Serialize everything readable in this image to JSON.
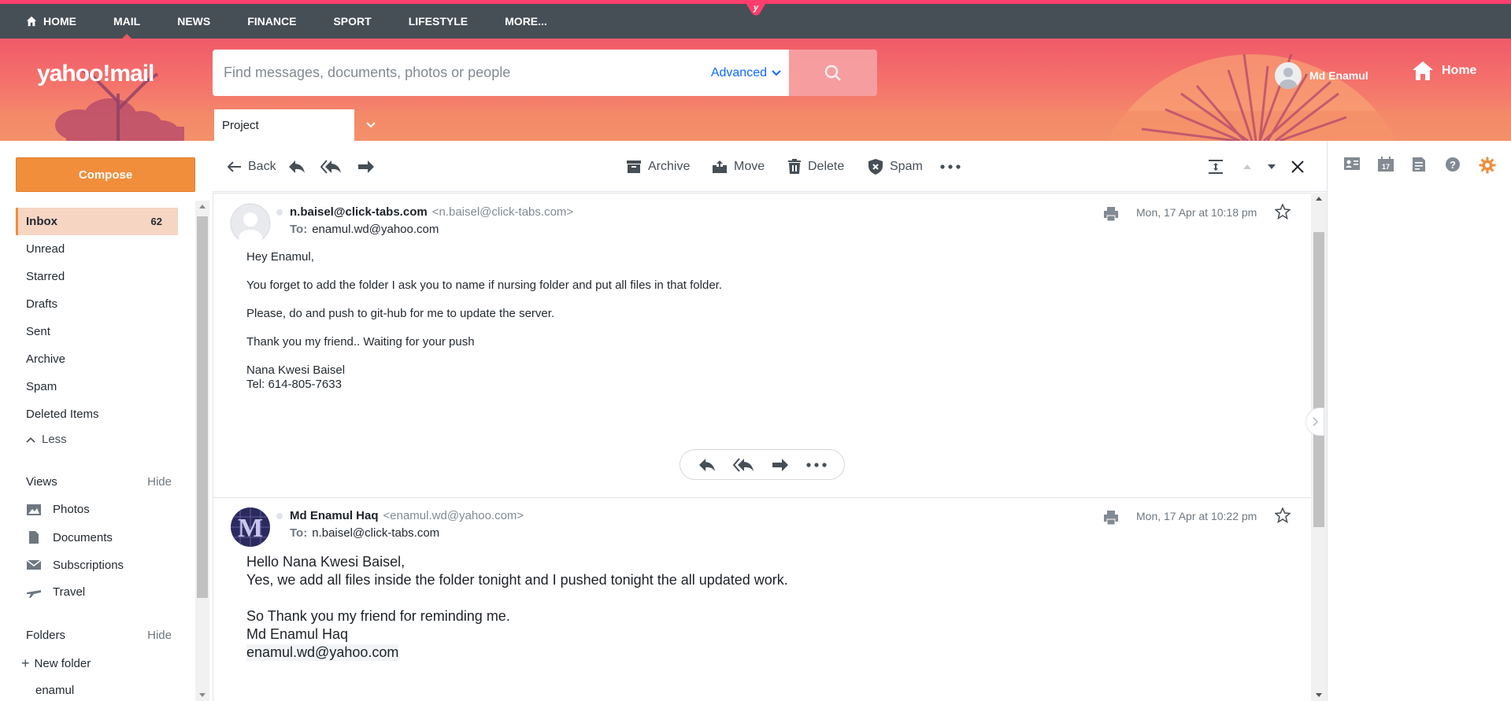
{
  "topnav": {
    "items": [
      {
        "label": "HOME"
      },
      {
        "label": "MAIL"
      },
      {
        "label": "NEWS"
      },
      {
        "label": "FINANCE"
      },
      {
        "label": "SPORT"
      },
      {
        "label": "LIFESTYLE"
      },
      {
        "label": "MORE..."
      }
    ],
    "active": "MAIL"
  },
  "header": {
    "logo": "yahoo!mail",
    "search_placeholder": "Find messages, documents, photos or people",
    "advanced_label": "Advanced",
    "user_name": "Md Enamul",
    "home_label": "Home",
    "tab_label": "Project"
  },
  "sidebar": {
    "compose_label": "Compose",
    "folders": [
      {
        "label": "Inbox",
        "count": "62"
      },
      {
        "label": "Unread"
      },
      {
        "label": "Starred"
      },
      {
        "label": "Drafts"
      },
      {
        "label": "Sent"
      },
      {
        "label": "Archive"
      },
      {
        "label": "Spam"
      },
      {
        "label": "Deleted Items"
      }
    ],
    "less_label": "Less",
    "views_label": "Views",
    "views_hide": "Hide",
    "views": [
      {
        "label": "Photos",
        "icon": "photos-icon"
      },
      {
        "label": "Documents",
        "icon": "document-icon"
      },
      {
        "label": "Subscriptions",
        "icon": "subscriptions-icon"
      },
      {
        "label": "Travel",
        "icon": "plane-icon"
      }
    ],
    "folders_label": "Folders",
    "folders_hide": "Hide",
    "new_folder_label": "New folder",
    "custom_folders": [
      {
        "label": "enamul"
      }
    ]
  },
  "toolbar": {
    "back_label": "Back",
    "archive_label": "Archive",
    "move_label": "Move",
    "delete_label": "Delete",
    "spam_label": "Spam"
  },
  "messages": [
    {
      "from_name": "n.baisel@click-tabs.com",
      "from_email": "<n.baisel@click-tabs.com>",
      "to_label": "To:",
      "to": "enamul.wd@yahoo.com",
      "date": "Mon, 17 Apr at 10:18 pm",
      "body": [
        "Hey Enamul,",
        "You forget to add the folder I ask you to name if nursing folder and put all files in that folder.",
        "Please, do and push to git-hub for me to update the server.",
        "Thank you my friend.. Waiting for your push",
        "Nana Kwesi Baisel",
        "Tel: 614-805-7633"
      ]
    },
    {
      "from_name": "Md Enamul Haq",
      "from_email": "<enamul.wd@yahoo.com>",
      "to_label": "To:",
      "to": "n.baisel@click-tabs.com",
      "date": "Mon, 17 Apr at 10:22 pm",
      "body": [
        "Hello Nana Kwesi Baisel,",
        "Yes, we add all files inside the folder tonight and I pushed tonight the all updated work.",
        "So Thank you my friend for reminding me.",
        "Md Enamul Haq",
        "enamul.wd@yahoo.com"
      ]
    }
  ],
  "colors": {
    "accent": "#f08e3c",
    "nav_bg": "#464e56",
    "nav_top": "#ff3e6c",
    "link_blue": "#0f69ff",
    "inbox_bg": "#f6d5c3"
  }
}
